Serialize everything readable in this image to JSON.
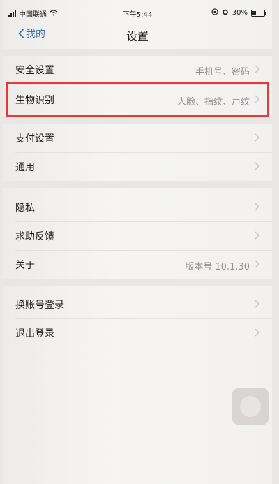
{
  "status_bar": {
    "carrier": "中国联通",
    "time": "下午5:44",
    "battery": "30%"
  },
  "nav": {
    "back_label": "我的",
    "title": "设置"
  },
  "groups": [
    {
      "rows": [
        {
          "label": "安全设置",
          "value": "手机号、密码"
        },
        {
          "label": "生物识别",
          "value": "人脸、指纹、声纹"
        }
      ]
    },
    {
      "rows": [
        {
          "label": "支付设置",
          "value": ""
        },
        {
          "label": "通用",
          "value": ""
        }
      ]
    },
    {
      "rows": [
        {
          "label": "隐私",
          "value": ""
        },
        {
          "label": "求助反馈",
          "value": ""
        },
        {
          "label": "关于",
          "value": "版本号 10.1.30"
        }
      ]
    },
    {
      "rows": [
        {
          "label": "换账号登录",
          "value": ""
        },
        {
          "label": "退出登录",
          "value": ""
        }
      ]
    }
  ],
  "colors": {
    "highlight": "#e63a3a",
    "link": "#3a6fb0"
  }
}
